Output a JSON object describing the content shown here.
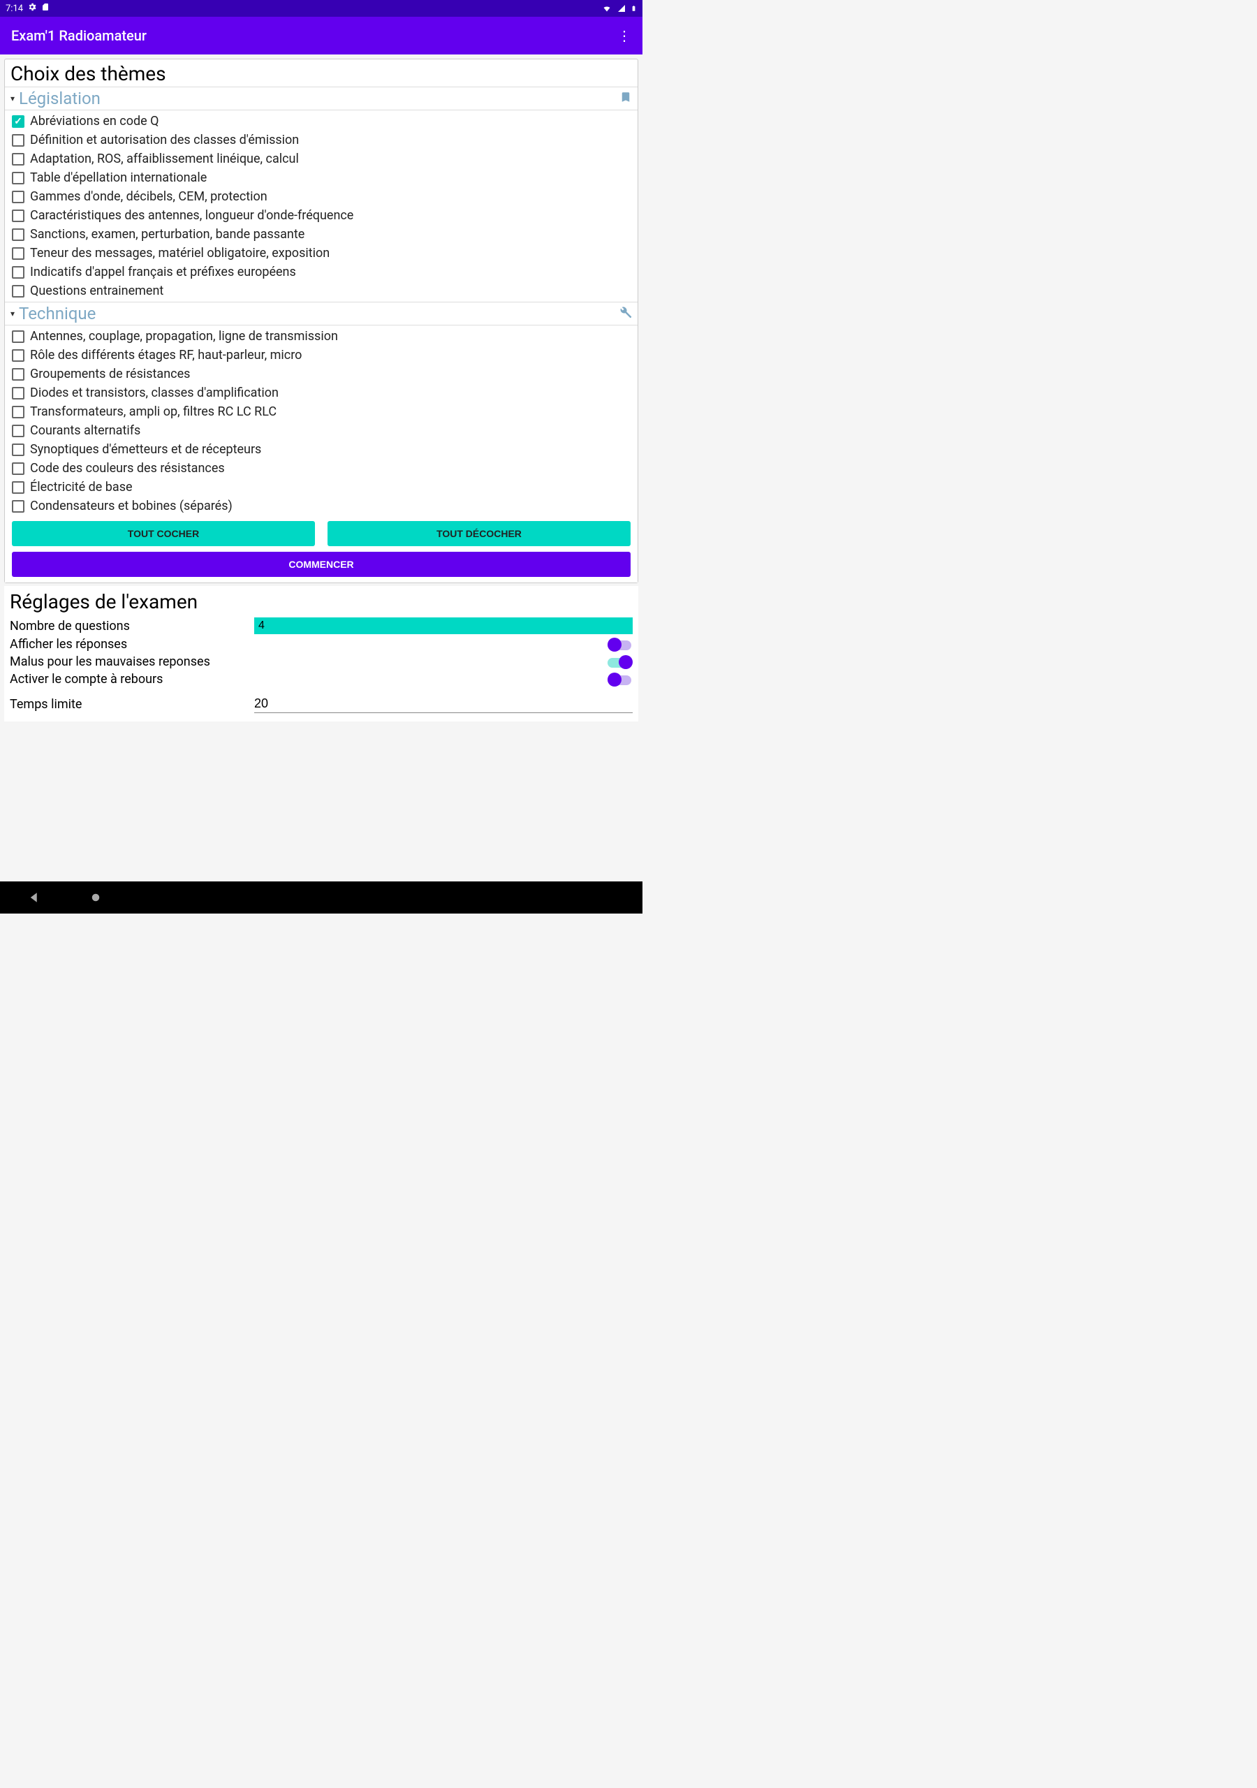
{
  "status": {
    "time": "7:14"
  },
  "appbar": {
    "title": "Exam'1 Radioamateur"
  },
  "page_title": "Choix des thèmes",
  "sections": [
    {
      "title": "Législation",
      "icon": "bookmark-icon",
      "items": [
        {
          "label": "Abréviations en code Q",
          "checked": true
        },
        {
          "label": "Définition et autorisation des classes d'émission",
          "checked": false
        },
        {
          "label": "Adaptation, ROS, affaiblissement linéique, calcul",
          "checked": false
        },
        {
          "label": "Table d'épellation internationale",
          "checked": false
        },
        {
          "label": "Gammes d'onde, décibels, CEM, protection",
          "checked": false
        },
        {
          "label": "Caractéristiques des antennes, longueur d'onde-fréquence",
          "checked": false
        },
        {
          "label": "Sanctions, examen, perturbation, bande passante",
          "checked": false
        },
        {
          "label": "Teneur des messages, matériel obligatoire, exposition",
          "checked": false
        },
        {
          "label": "Indicatifs d'appel français et préfixes européens",
          "checked": false
        },
        {
          "label": "Questions entrainement",
          "checked": false
        }
      ]
    },
    {
      "title": "Technique",
      "icon": "wrench-icon",
      "items": [
        {
          "label": "Antennes, couplage, propagation, ligne de transmission",
          "checked": false
        },
        {
          "label": "Rôle des différents étages RF, haut-parleur, micro",
          "checked": false
        },
        {
          "label": "Groupements de résistances",
          "checked": false
        },
        {
          "label": "Diodes et transistors, classes d'amplification",
          "checked": false
        },
        {
          "label": "Transformateurs, ampli op, filtres RC LC RLC",
          "checked": false
        },
        {
          "label": "Courants alternatifs",
          "checked": false
        },
        {
          "label": "Synoptiques d'émetteurs et de récepteurs",
          "checked": false
        },
        {
          "label": "Code des couleurs des résistances",
          "checked": false
        },
        {
          "label": "Électricité de base",
          "checked": false
        },
        {
          "label": "Condensateurs et bobines (séparés)",
          "checked": false
        }
      ]
    }
  ],
  "buttons": {
    "check_all": "TOUT COCHER",
    "uncheck_all": "TOUT DÉCOCHER",
    "start": "COMMENCER"
  },
  "settings": {
    "title": "Réglages de l'examen",
    "question_count_label": "Nombre de questions",
    "question_count_value": "4",
    "show_answers_label": "Afficher les réponses",
    "show_answers_on": true,
    "malus_label": "Malus pour les mauvaises reponses",
    "malus_on": true,
    "countdown_label": "Activer le compte à rebours",
    "countdown_on": true,
    "time_limit_label": "Temps limite",
    "time_limit_value": "20"
  }
}
